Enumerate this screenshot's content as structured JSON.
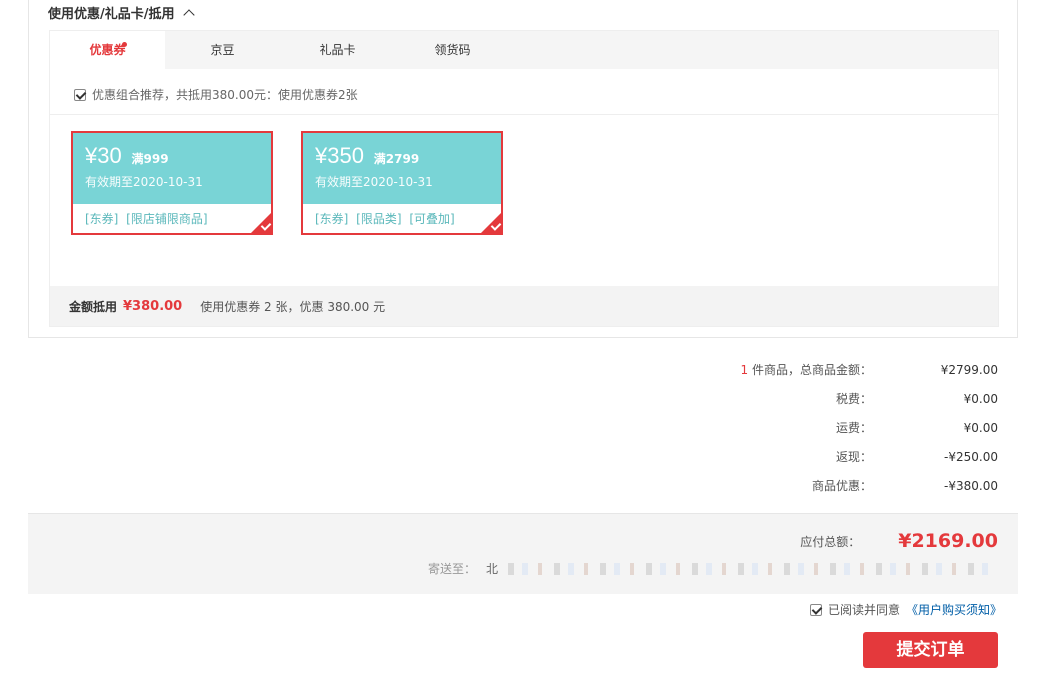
{
  "section": {
    "title": "使用优惠/礼品卡/抵用"
  },
  "tabs": [
    {
      "label": "优惠券"
    },
    {
      "label": "京豆"
    },
    {
      "label": "礼品卡"
    },
    {
      "label": "领货码"
    }
  ],
  "combo": {
    "label": "优惠组合推荐，共抵用380.00元：使用优惠券2张",
    "checked": true
  },
  "coupons": [
    {
      "amount": "¥30",
      "condition": "满999",
      "validity": "有效期至2020-10-31",
      "tags": "[东券] [限店铺限商品]",
      "selected": true
    },
    {
      "amount": "¥350",
      "condition": "满2799",
      "validity": "有效期至2020-10-31",
      "tags": "[东券] [限品类] [可叠加]",
      "selected": true
    }
  ],
  "coupon_footer": {
    "label": "金额抵用",
    "value": "¥380.00",
    "note": "使用优惠券 2 张，优惠 380.00 元"
  },
  "summary": {
    "items_count": "1",
    "items_label": "件商品，总商品金额：",
    "items_total": "¥2799.00",
    "tax_label": "税费：",
    "tax": "¥0.00",
    "shipping_label": "运费：",
    "shipping": "¥0.00",
    "cashback_label": "返现：",
    "cashback": "-¥250.00",
    "discount_label": "商品优惠：",
    "discount": "-¥380.00"
  },
  "payment": {
    "label": "应付总额：",
    "total": "¥2169.00",
    "ship_to_label": "寄送至：",
    "ship_to_prefix": "北"
  },
  "agreement": {
    "text": "已阅读并同意",
    "link": "《用户购买须知》",
    "checked": true
  },
  "submit": {
    "label": "提交订单"
  },
  "colors": {
    "accent": "#e4393c",
    "coupon_bg": "#79d4d6",
    "link": "#005ea7"
  }
}
